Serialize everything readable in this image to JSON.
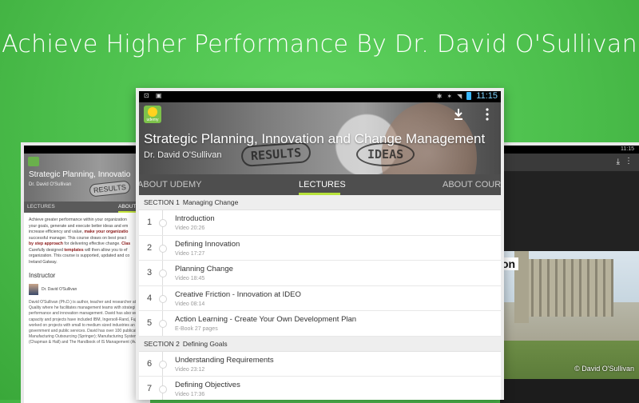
{
  "headline": "Achieve Higher Performance By Dr. David O'Sullivan",
  "main": {
    "status": {
      "time": "11:15",
      "left_icons": "⊡ ▣"
    },
    "hero": {
      "title": "Strategic Planning, Innovation and Change Management",
      "author": "Dr. David O'Sullivan",
      "sketch_results": "RESULTS",
      "sketch_ideas": "IDEAS",
      "app_icon_text": "udemy"
    },
    "tabs": {
      "left": "ABOUT UDEMY",
      "center": "LECTURES",
      "right": "ABOUT COURSE"
    },
    "sections": [
      {
        "number": "SECTION 1",
        "title": "Managing Change",
        "lectures": [
          {
            "num": "1",
            "title": "Introduction",
            "meta": "Video 20:26"
          },
          {
            "num": "2",
            "title": "Defining Innovation",
            "meta": "Video 17:27"
          },
          {
            "num": "3",
            "title": "Planning Change",
            "meta": "Video 18:45"
          },
          {
            "num": "4",
            "title": "Creative Friction - Innovation at IDEO",
            "meta": "Video 08:14"
          },
          {
            "num": "5",
            "title": "Action Learning - Create Your Own Development Plan",
            "meta": "E-Book 27 pages"
          }
        ]
      },
      {
        "number": "SECTION 2",
        "title": "Defining Goals",
        "lectures": [
          {
            "num": "6",
            "title": "Understanding Requirements",
            "meta": "Video 23:12"
          },
          {
            "num": "7",
            "title": "Defining Objectives",
            "meta": "Video 17:36"
          }
        ]
      }
    ]
  },
  "left_tablet": {
    "title": "Strategic Planning, Innovatio",
    "author": "Dr. David O'Sullivan",
    "sketch": "RESULTS",
    "tab_lectures": "LECTURES",
    "tab_about": "ABOUT C",
    "desc_1": "Achieve greater performance within your organization",
    "desc_2": "your goals, generate and execute better ideas and em",
    "desc_3": "increase efficiency and value,",
    "desc_3b": "make your organizatio",
    "desc_4": "successful manager. This course draws on best pract",
    "desc_5b": "by step approach",
    "desc_5": "for delivering effective change.",
    "desc_5c": "Clas",
    "desc_6": "Carefully designed",
    "desc_6b": "templates",
    "desc_6c": "will then allow you to ef",
    "desc_7": "organization. This course is supported, updated and co",
    "desc_8": "Ireland Galway.",
    "instructor_heading": "Instructor",
    "instructor_name": "Dr. David O'Sullivan",
    "bio_1": "David O'Sullivan (Ph.D.) is author, teacher and researcher at I",
    "bio_2": "Quality where he facilitates management teams with strategi",
    "bio_3": "performance and innovation management. David has also wo",
    "bio_4": "capacity and projects have included IBM, Ingersoll-Rand, Fuji",
    "bio_5": "worked on projects with small to medium sized industries an",
    "bio_6": "government and public services. David has over 100 publicat",
    "bio_7": "Manufacturing Outsourcing (Springer); Manufacturing System",
    "bio_8": "(Chapman & Hall) and The Handbook of IS Management (Au"
  },
  "right_tablet": {
    "status": "11:15",
    "photo_text": "on",
    "credit": "© David O'Sullivan"
  }
}
